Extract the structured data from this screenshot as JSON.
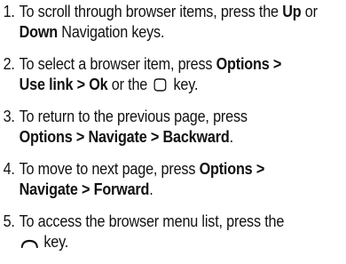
{
  "steps": [
    {
      "number": "1.",
      "text_a": "To scroll through browser items, press the ",
      "up": "Up",
      "or": " or ",
      "down": "Down",
      "text_b": " Navigation keys."
    },
    {
      "number": "2.",
      "text_a": "To select a browser item, press ",
      "options": "Options >",
      "use_link": "Use link > Ok",
      "text_b": " or the ",
      "key_icon": "center-select-key-icon",
      "text_c": " key."
    },
    {
      "number": "3.",
      "text_a": "To return to the previous page, press ",
      "path": "Options > Navigate > Backward",
      "text_b": "."
    },
    {
      "number": "4.",
      "text_a": "To move to next page, press ",
      "options": "Options >",
      "path": "Navigate > Forward",
      "text_b": "."
    },
    {
      "number": "5.",
      "text_a": "To access the browser menu list, press the",
      "key_icon": "soft-key-icon",
      "text_b": " key."
    }
  ]
}
